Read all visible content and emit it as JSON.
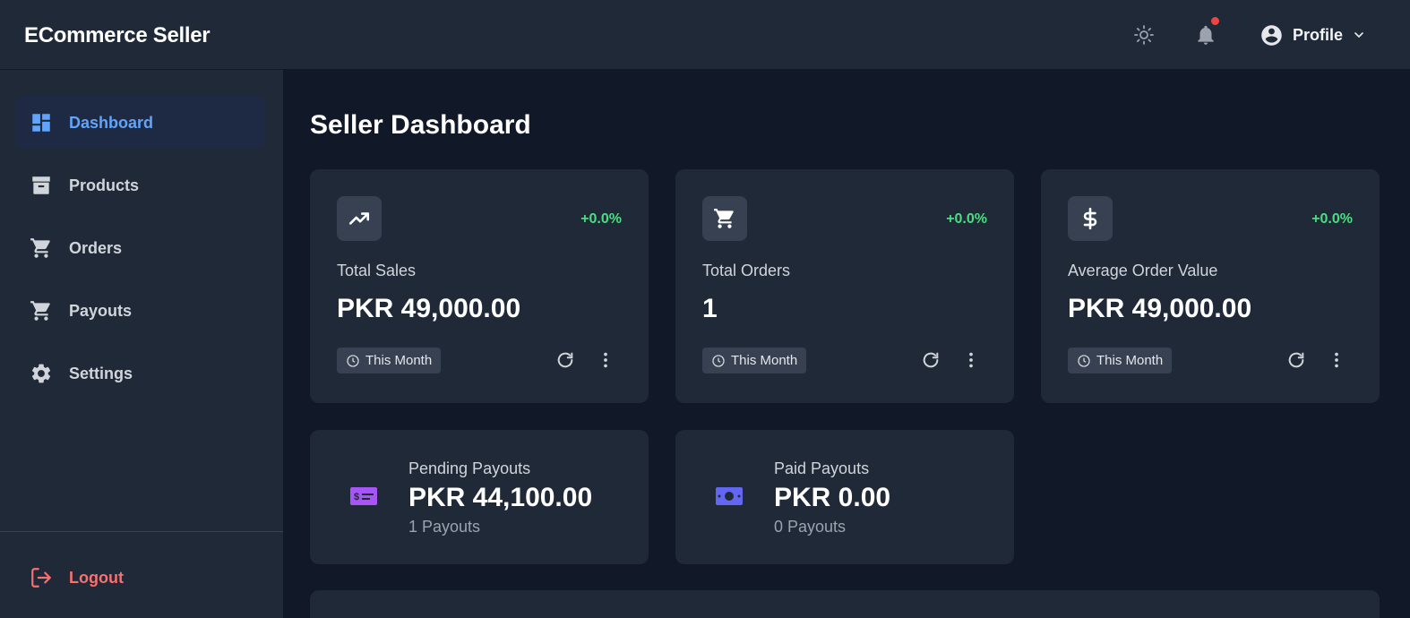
{
  "header": {
    "brand": "ECommerce Seller",
    "profile_label": "Profile",
    "icons": [
      "sun-icon",
      "bell-icon",
      "account-circle-icon",
      "chevron-down-icon"
    ],
    "notification_dot_color": "#ef4444"
  },
  "sidebar": {
    "items": [
      {
        "label": "Dashboard",
        "icon": "dashboard-icon",
        "active": true
      },
      {
        "label": "Products",
        "icon": "archive-box-icon",
        "active": false
      },
      {
        "label": "Orders",
        "icon": "cart-icon",
        "active": false
      },
      {
        "label": "Payouts",
        "icon": "cart-icon",
        "active": false
      },
      {
        "label": "Settings",
        "icon": "gear-icon",
        "active": false
      }
    ],
    "logout_label": "Logout"
  },
  "main": {
    "title": "Seller Dashboard",
    "stats": [
      {
        "label": "Total Sales",
        "value": "PKR 49,000.00",
        "change": "+0.0%",
        "period": "This Month",
        "icon": "trending-up-icon"
      },
      {
        "label": "Total Orders",
        "value": "1",
        "change": "+0.0%",
        "period": "This Month",
        "icon": "cart-icon"
      },
      {
        "label": "Average Order Value",
        "value": "PKR 49,000.00",
        "change": "+0.0%",
        "period": "This Month",
        "icon": "dollar-icon"
      }
    ],
    "payouts": [
      {
        "label": "Pending Payouts",
        "value": "PKR 44,100.00",
        "count": "1 Payouts",
        "icon": "payout-check-icon",
        "color": "#a855f7"
      },
      {
        "label": "Paid Payouts",
        "value": "PKR 0.00",
        "count": "0 Payouts",
        "icon": "banknote-icon",
        "color": "#6366f1"
      }
    ]
  },
  "colors": {
    "accent": "#60a5fa",
    "positive": "#4ade80",
    "danger": "#f87171",
    "card_bg": "#1f2937",
    "page_bg": "#111827"
  }
}
